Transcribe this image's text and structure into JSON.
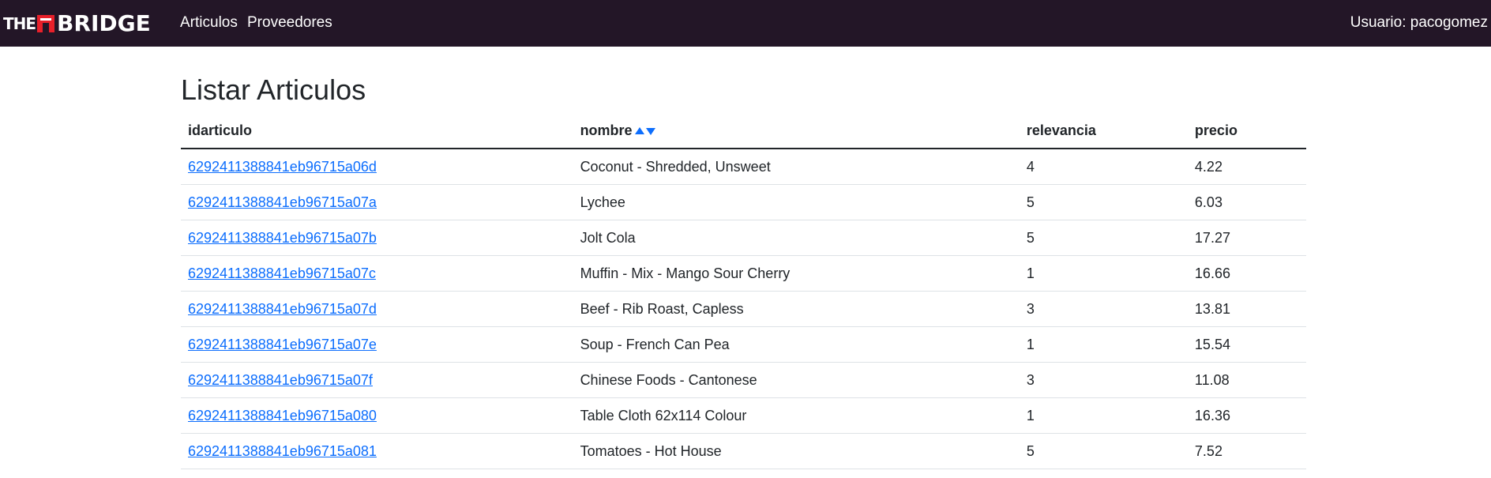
{
  "navbar": {
    "brand_the": "THE",
    "brand_bridge": "BRIDGE",
    "links": [
      {
        "label": "Articulos"
      },
      {
        "label": "Proveedores"
      }
    ],
    "user": "Usuario: pacogomez"
  },
  "page": {
    "title": "Listar Articulos"
  },
  "table": {
    "headers": {
      "id": "idarticulo",
      "nombre": "nombre",
      "relevancia": "relevancia",
      "precio": "precio"
    },
    "sort_icons": [
      "sort-ascending-icon",
      "sort-descending-icon"
    ],
    "accent_color": "#0d6efd",
    "rows": [
      {
        "id": "6292411388841eb96715a06d",
        "nombre": "Coconut - Shredded, Unsweet",
        "relevancia": "4",
        "precio": "4.22"
      },
      {
        "id": "6292411388841eb96715a07a",
        "nombre": "Lychee",
        "relevancia": "5",
        "precio": "6.03"
      },
      {
        "id": "6292411388841eb96715a07b",
        "nombre": "Jolt Cola",
        "relevancia": "5",
        "precio": "17.27"
      },
      {
        "id": "6292411388841eb96715a07c",
        "nombre": "Muffin - Mix - Mango Sour Cherry",
        "relevancia": "1",
        "precio": "16.66"
      },
      {
        "id": "6292411388841eb96715a07d",
        "nombre": "Beef - Rib Roast, Capless",
        "relevancia": "3",
        "precio": "13.81"
      },
      {
        "id": "6292411388841eb96715a07e",
        "nombre": "Soup - French Can Pea",
        "relevancia": "1",
        "precio": "15.54"
      },
      {
        "id": "6292411388841eb96715a07f",
        "nombre": "Chinese Foods - Cantonese",
        "relevancia": "3",
        "precio": "11.08"
      },
      {
        "id": "6292411388841eb96715a080",
        "nombre": "Table Cloth 62x114 Colour",
        "relevancia": "1",
        "precio": "16.36"
      },
      {
        "id": "6292411388841eb96715a081",
        "nombre": "Tomatoes - Hot House",
        "relevancia": "5",
        "precio": "7.52"
      }
    ]
  },
  "colors": {
    "navbar_bg": "#231627",
    "brand_red": "#e8202a",
    "link": "#0d6efd"
  }
}
